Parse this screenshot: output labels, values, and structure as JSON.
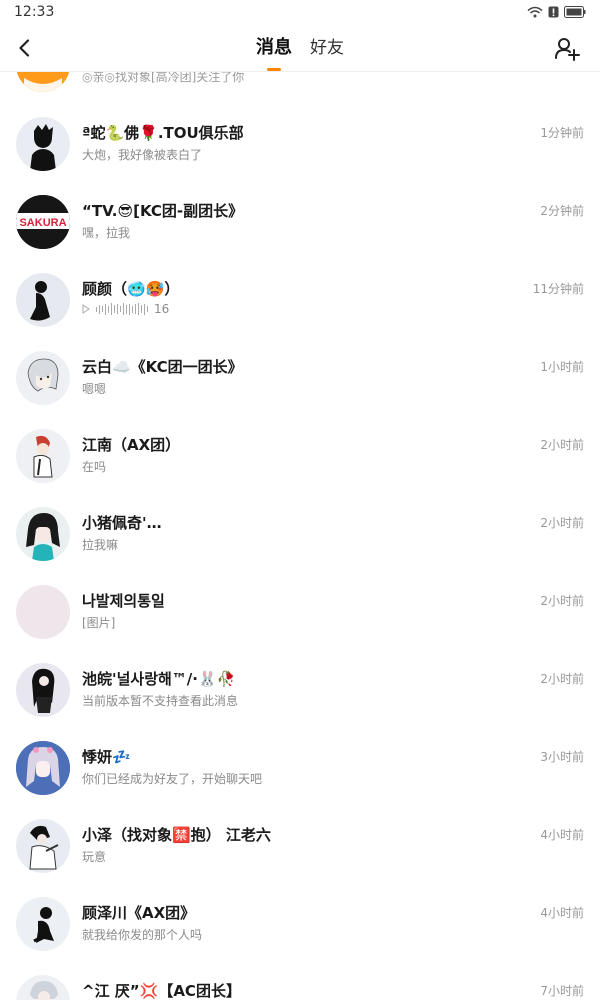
{
  "status_bar": {
    "time": "12:33"
  },
  "nav": {
    "tabs": [
      {
        "label": "消息",
        "active": true
      },
      {
        "label": "好友",
        "active": false
      }
    ]
  },
  "accent_color": "#ff8200",
  "partial_row": {
    "preview": "◎亲◎找对象[高冷团]关注了你"
  },
  "conversations": [
    {
      "name": "ª蛇🐍佛🌹.TOU俱乐部",
      "preview": "大炮，我好像被表白了",
      "time": "1分钟前"
    },
    {
      "name": "“TV.😎[KC团-副团长》",
      "preview": "嘿，拉我",
      "time": "2分钟前",
      "avatar_text": "SAKURA"
    },
    {
      "name": "顾颜（🥶🥵）",
      "preview_voice": {
        "duration": "16"
      },
      "time": "11分钟前"
    },
    {
      "name": "云白☁️《KC团一团长》",
      "preview": "嗯嗯",
      "time": "1小时前"
    },
    {
      "name": "江南（AX团）",
      "preview": "在吗",
      "time": "2小时前"
    },
    {
      "name": "小猪佩奇'…",
      "preview": "拉我嘛",
      "time": "2小时前"
    },
    {
      "name": "나발제의통일",
      "preview": "[图片]",
      "time": "2小时前"
    },
    {
      "name": "池皖'널사랑해™/·🐰🥀",
      "preview": "当前版本暂不支持查看此消息",
      "time": "2小时前"
    },
    {
      "name": "悸妍💤",
      "preview": "你们已经成为好友了，开始聊天吧",
      "time": "3小时前"
    },
    {
      "name": "小泽（找对象🈲抱） 江老六",
      "preview": "玩意",
      "time": "4小时前"
    },
    {
      "name": "顾泽川《AX团》",
      "preview": "就我给你发的那个人吗",
      "time": "4小时前"
    },
    {
      "name": "^江 厌”💢【AC团长】",
      "preview": "",
      "time": "7小时前"
    }
  ]
}
